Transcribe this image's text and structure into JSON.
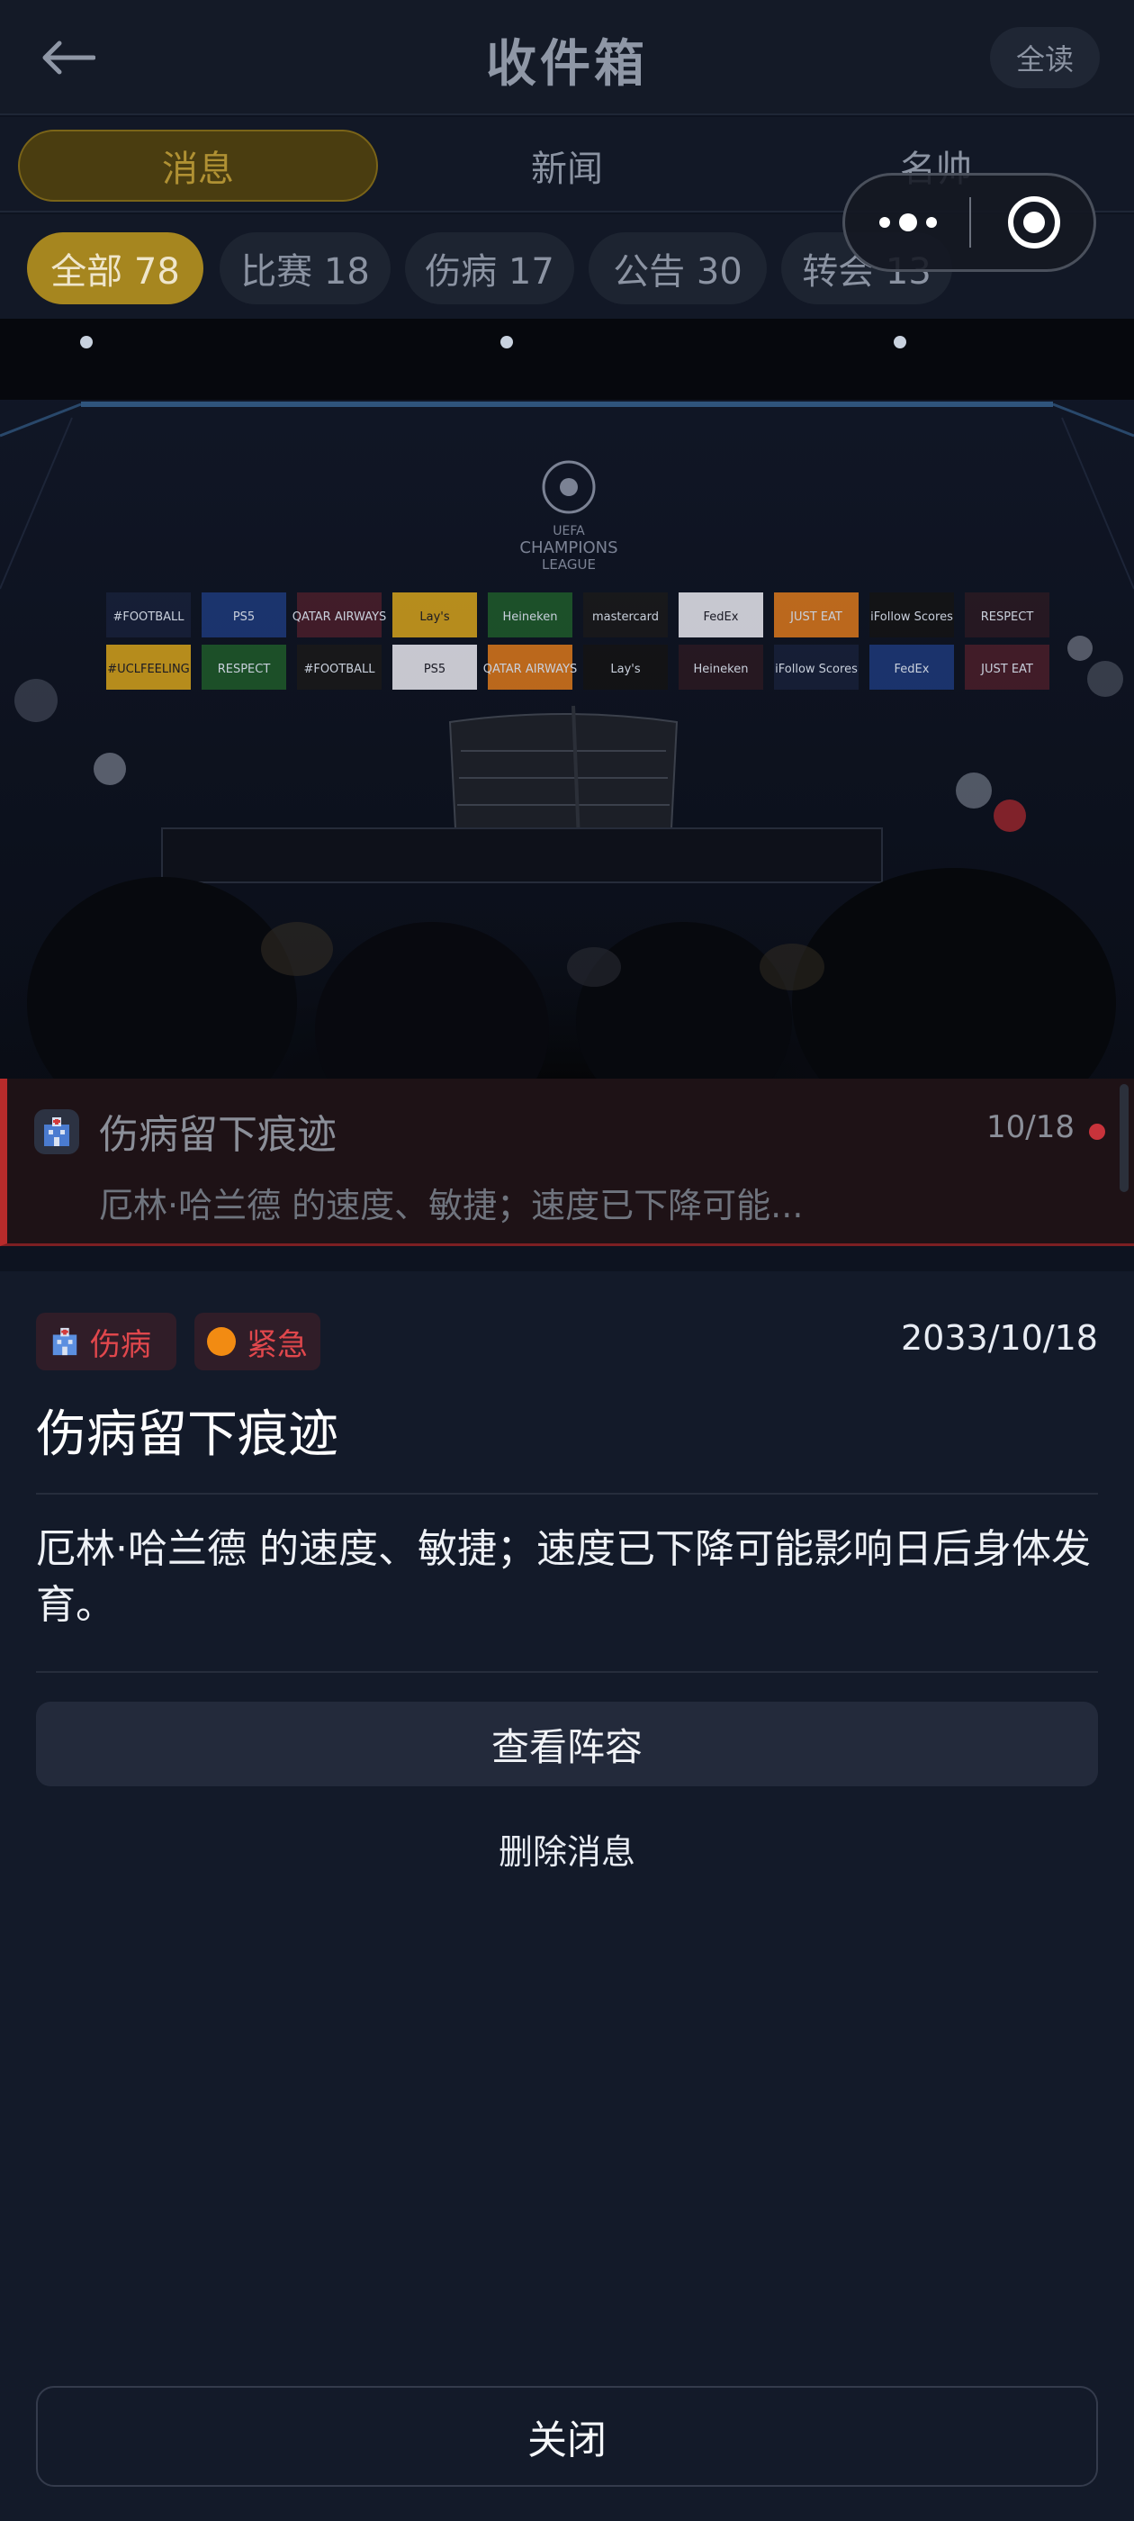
{
  "header": {
    "title": "收件箱",
    "read_all": "全读"
  },
  "main_tabs": [
    {
      "label": "消息",
      "active": true
    },
    {
      "label": "新闻",
      "active": false
    },
    {
      "label": "名帅",
      "active": false
    }
  ],
  "filters": [
    {
      "label": "全部 78",
      "active": true
    },
    {
      "label": "比赛 18",
      "active": false
    },
    {
      "label": "伤病 17",
      "active": false
    },
    {
      "label": "公告 30",
      "active": false
    },
    {
      "label": "转会 13",
      "active": false
    }
  ],
  "hero": {
    "logo_line1": "UEFA",
    "logo_line2": "CHAMPIONS",
    "logo_line3": "LEAGUE",
    "sponsors_row1": [
      "#FOOTBALL",
      "PS5",
      "QATAR AIRWAYS",
      "Lay's",
      "Heineken",
      "mastercard",
      "FedEx",
      "JUST EAT",
      "iFollow Scores",
      "RESPECT"
    ],
    "sponsors_row2": [
      "#UCLFEELING",
      "RESPECT",
      "#FOOTBALL",
      "PS5",
      "QATAR AIRWAYS",
      "Lay's",
      "Heineken",
      "iFollow Scores",
      "FedEx",
      "JUST EAT"
    ]
  },
  "message": {
    "icon": "hospital-icon",
    "title": "伤病留下痕迹",
    "date": "10/18",
    "preview": "厄林·哈兰德 的速度、敏捷；速度已下降可能...",
    "unread": true
  },
  "detail": {
    "tag_injury": "伤病",
    "tag_urgent": "紧急",
    "date": "2033/10/18",
    "title": "伤病留下痕迹",
    "body": "厄林·哈兰德 的速度、敏捷；速度已下降可能影响日后身体发育。",
    "view_lineup": "查看阵容",
    "delete": "删除消息",
    "close": "关闭"
  },
  "colors": {
    "accent_gold": "#a6861f",
    "urgent_red": "#e0474c",
    "urgent_orange": "#f28b12",
    "background": "#131a29"
  }
}
